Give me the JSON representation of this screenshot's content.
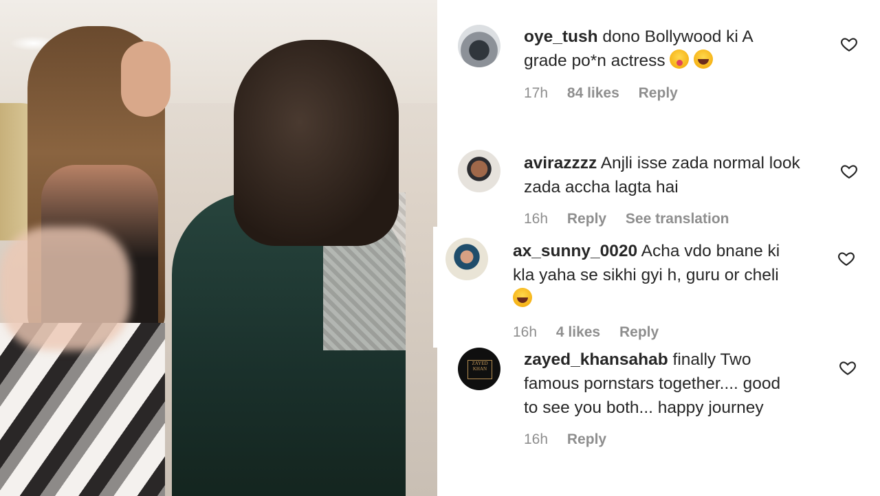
{
  "comments": [
    {
      "username": "oye_tush",
      "text_line1": "dono Bollywood ki A",
      "text_line2": "grade po*n actress",
      "emojis": [
        "face-with-tongue",
        "tears-of-joy"
      ],
      "time": "17h",
      "likes": "84 likes",
      "reply": "Reply"
    },
    {
      "username": "avirazzzz",
      "text_line1": "Anjli isse zada normal look",
      "text_line2": "zada accha lagta hai",
      "time": "16h",
      "reply": "Reply",
      "translation": "See translation"
    },
    {
      "username": "ax_sunny_0020",
      "text_line1": "Acha vdo bnane ki",
      "text_line2": "kla yaha se sikhi gyi h, guru or cheli",
      "emojis": [
        "tears-of-joy"
      ],
      "time": "16h",
      "likes": "4 likes",
      "reply": "Reply"
    },
    {
      "username": "zayed_khansahab",
      "text_line1": "finally Two",
      "text_line2": "famous pornstars together.... good",
      "text_line3": "to see you both... happy journey",
      "avatar_logo": "ZAYED KHAN",
      "time": "16h",
      "reply": "Reply"
    }
  ],
  "icons": {
    "like": "heart-outline-icon"
  },
  "colors": {
    "text": "#262626",
    "muted": "#8e8e8e"
  }
}
